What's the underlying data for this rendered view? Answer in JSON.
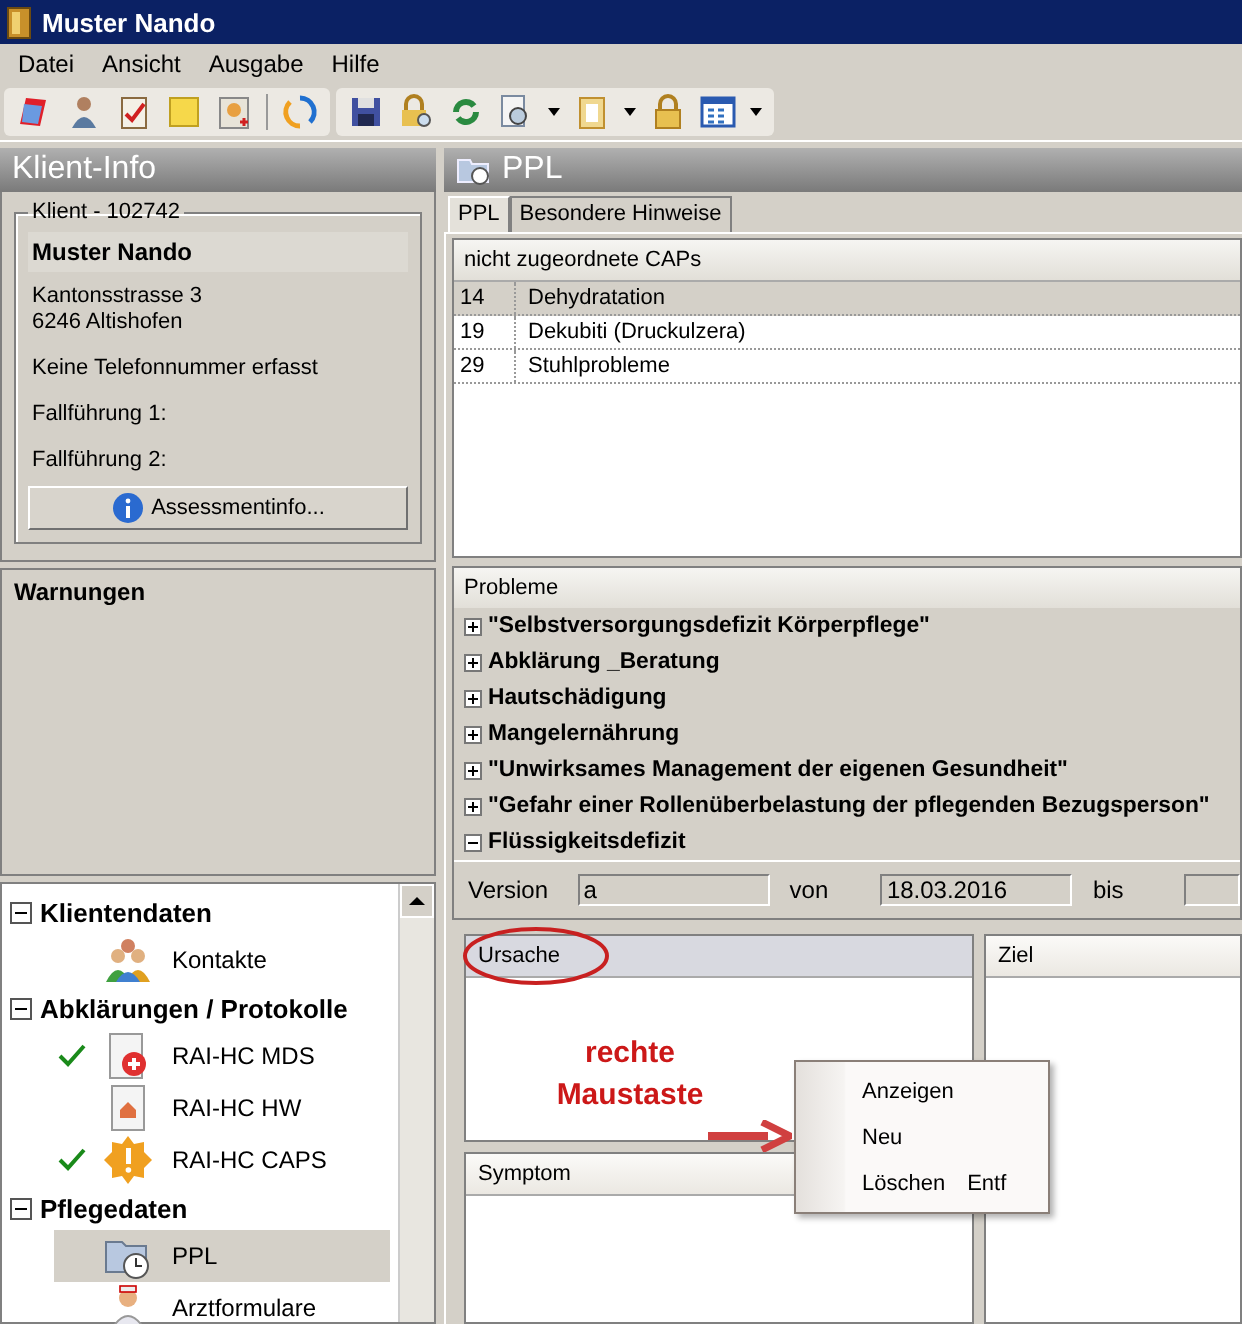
{
  "window": {
    "title": "Muster Nando"
  },
  "menu": [
    {
      "label": "Datei"
    },
    {
      "label": "Ansicht"
    },
    {
      "label": "Ausgabe"
    },
    {
      "label": "Hilfe"
    }
  ],
  "client_info": {
    "title": "Klient-Info",
    "group_label": "Klient - 102742",
    "name": "Muster  Nando",
    "address": [
      "Kantonsstrasse 3",
      "6246 Altishofen"
    ],
    "phone": "Keine Telefonnummer erfasst",
    "case_lines": [
      "Fallführung 1:",
      "Fallführung 2:"
    ],
    "button": "Assessmentinfo..."
  },
  "warnings": {
    "title": "Warnungen"
  },
  "nav_tree": [
    {
      "label": "Klientendaten",
      "expanded": true,
      "children": [
        {
          "label": "Kontakte",
          "kind": "contacts",
          "checked": false,
          "selected": false
        }
      ]
    },
    {
      "label": "Abklärungen / Protokolle",
      "expanded": true,
      "children": [
        {
          "label": "RAI-HC MDS",
          "kind": "medical",
          "checked": true,
          "selected": false
        },
        {
          "label": "RAI-HC HW",
          "kind": "home",
          "checked": false,
          "selected": false
        },
        {
          "label": "RAI-HC CAPS",
          "kind": "alert",
          "checked": true,
          "selected": false
        }
      ]
    },
    {
      "label": "Pflegedaten",
      "expanded": true,
      "children": [
        {
          "label": "PPL",
          "kind": "plan",
          "checked": false,
          "selected": true
        },
        {
          "label": "Arztformulare",
          "kind": "doctor",
          "checked": false,
          "selected": false
        }
      ]
    }
  ],
  "ppl": {
    "title": "PPL",
    "tabs": [
      {
        "label": "PPL",
        "selected": true
      },
      {
        "label": "Besondere Hinweise",
        "selected": false
      }
    ],
    "caps": {
      "title": "nicht zugeordnete CAPs",
      "rows": [
        {
          "number": "14",
          "name": "Dehydratation",
          "selected": true
        },
        {
          "number": "19",
          "name": "Dekubiti (Druckulzera)",
          "selected": false
        },
        {
          "number": "29",
          "name": "Stuhlprobleme",
          "selected": false
        }
      ]
    },
    "problems": {
      "title": "Probleme",
      "items": [
        {
          "label": "\"Selbstversorgungsdefizit Körperpflege\"",
          "expanded": false
        },
        {
          "label": "Abklärung _Beratung",
          "expanded": false
        },
        {
          "label": "Hautschädigung",
          "expanded": false
        },
        {
          "label": "Mangelernährung",
          "expanded": false
        },
        {
          "label": "\"Unwirksames Management der eigenen Gesundheit\"",
          "expanded": false
        },
        {
          "label": "\"Gefahr einer Rollenüberbelastung der pflegenden Bezugsperson\"",
          "expanded": false
        },
        {
          "label": "Flüssigkeitsdefizit",
          "expanded": true,
          "version": {
            "label": "Version",
            "value": "a",
            "from_label": "von",
            "from_value": "18.03.2016",
            "to_label": "bis"
          }
        }
      ]
    },
    "panels": [
      {
        "title": "Ursache",
        "highlighted": true
      },
      {
        "title": "Symptom",
        "highlighted": false
      },
      {
        "title": "Ziel",
        "highlighted": false
      }
    ]
  },
  "annotation": {
    "text": "rechte Maustaste"
  },
  "context_menu": [
    {
      "label": "Anzeigen"
    },
    {
      "label": "Neu"
    },
    {
      "label": "Löschen",
      "shortcut": "Entf"
    }
  ]
}
